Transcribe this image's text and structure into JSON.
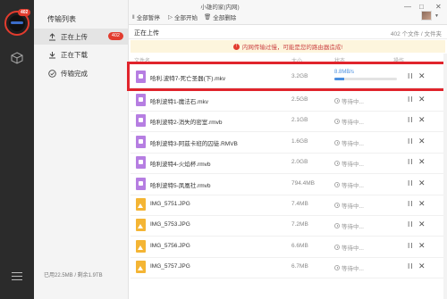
{
  "rail": {
    "avatar_badge": "402",
    "icons": [
      "cube-icon",
      "menu-icon"
    ]
  },
  "sidebar": {
    "title": "传输列表",
    "items": [
      {
        "label": "正在上传",
        "badge": "402",
        "icon": "upload-icon",
        "active": true
      },
      {
        "label": "正在下载",
        "icon": "download-icon",
        "active": false
      },
      {
        "label": "传输完成",
        "icon": "check-circle-icon",
        "active": false
      }
    ],
    "footer": "已用22.5MB / 剩余1.9TB"
  },
  "topbar": {
    "window_title": "小雄的家(内网)",
    "pause_all": "全部暂停",
    "start_all": "全部开始",
    "delete_all": "全部删除",
    "controls": [
      "—",
      "□",
      "✕"
    ]
  },
  "section": {
    "title": "正在上传",
    "count": "402 个文件 / 文件夹"
  },
  "banner": {
    "text": "内网传输过慢，可能是您的路由器造成!"
  },
  "columns": {
    "name": "文件名",
    "size": "大小",
    "status": "状态",
    "actions": "操作"
  },
  "active_row": {
    "name": "哈利.波特7-死亡圣器(下).mkv",
    "size": "3.2GB",
    "speed": "8.8MB/s",
    "progress": 0.15,
    "type": "video"
  },
  "rows": [
    {
      "name": "哈利波特1-魔法石.mkv",
      "size": "2.5GB",
      "status": "等待中...",
      "type": "video"
    },
    {
      "name": "哈利波特2-消失的密室.rmvb",
      "size": "2.1GB",
      "status": "等待中...",
      "type": "video"
    },
    {
      "name": "哈利波特3-阿兹卡班的囚徒.RMVB",
      "size": "1.6GB",
      "status": "等待中...",
      "type": "video"
    },
    {
      "name": "哈利波特4-火焰杯.rmvb",
      "size": "2.0GB",
      "status": "等待中...",
      "type": "video"
    },
    {
      "name": "哈利波特5-凤凰社.rmvb",
      "size": "794.4MB",
      "status": "等待中...",
      "type": "video"
    },
    {
      "name": "IMG_5751.JPG",
      "size": "7.4MB",
      "status": "等待中...",
      "type": "image"
    },
    {
      "name": "IMG_5753.JPG",
      "size": "7.2MB",
      "status": "等待中...",
      "type": "image"
    },
    {
      "name": "IMG_5756.JPG",
      "size": "6.6MB",
      "status": "等待中...",
      "type": "image"
    },
    {
      "name": "IMG_5757.JPG",
      "size": "6.7MB",
      "status": "等待中...",
      "type": "image"
    }
  ],
  "colors": {
    "rail_bg": "#2b2b2b",
    "accent_red": "#e23c2e",
    "progress_blue": "#4a8fe0",
    "video_icon": "#b67ee2",
    "image_icon": "#f4b534",
    "banner_bg": "#fdf5dd"
  }
}
